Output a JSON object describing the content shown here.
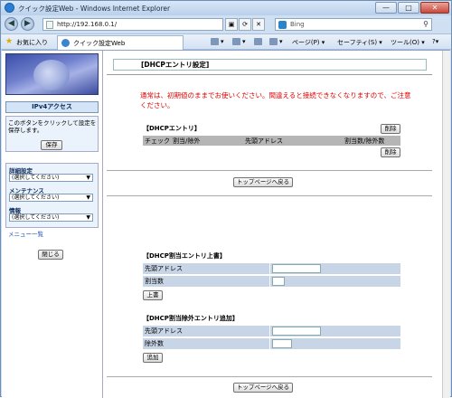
{
  "window": {
    "title": "クイック設定Web - Windows Internet Explorer",
    "minimize": "—",
    "maximize": "□",
    "close": "✕"
  },
  "addressbar": {
    "url": "http://192.168.0.1/",
    "search_placeholder": "Bing"
  },
  "favbar": {
    "favorites_label": "お気に入り",
    "tab_label": "クイック設定Web",
    "page_menu": "ページ(P) ▾",
    "safety_menu": "セーフティ(S) ▾",
    "tools_menu": "ツール(O) ▾",
    "help_menu": "?▾"
  },
  "sidebar": {
    "ipv4_label": "IPv4アクセス",
    "save_desc": "このボタンをクリックして設定を保存します。",
    "save_button": "保存",
    "menus": [
      {
        "label": "詳細設定",
        "selected": "(選択してください)"
      },
      {
        "label": "メンテナンス",
        "selected": "(選択してください)"
      },
      {
        "label": "情報",
        "selected": "(選択してください)"
      }
    ],
    "menu_list_link": "メニュー一覧",
    "close_button": "閉じる"
  },
  "main": {
    "heading": "[DHCPエントリ設定]",
    "notice": "通常は、初期値のままでお使いください。間違えると接続できなくなりますので、ご注意ください。",
    "entries_title": "【DHCPエントリ】",
    "delete_button": "削除",
    "table_headers": [
      "チェック",
      "割当/除外",
      "先頭アドレス",
      "割当数/除外数"
    ],
    "top_button": "トップページへ戻る",
    "overwrite_title": "【DHCP割当エントリ上書】",
    "overwrite_rows": [
      "先頭アドレス",
      "割当数"
    ],
    "overwrite_button": "上書",
    "exclude_title": "【DHCP割当除外エントリ追加】",
    "exclude_rows": [
      "先頭アドレス",
      "除外数"
    ],
    "add_button": "追加"
  }
}
